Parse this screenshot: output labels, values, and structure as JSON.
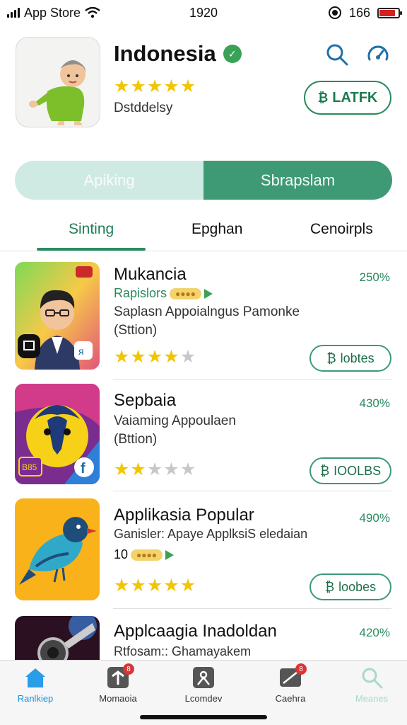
{
  "status_bar": {
    "carrier": "App Store",
    "time": "1920",
    "battery": "166",
    "battery_level": 0.85
  },
  "app": {
    "title": "Indonesia",
    "subtitle": "Dstddelsy",
    "rating": 4.5,
    "get_label": "LATFK",
    "icons": [
      "search-icon",
      "gauge-icon",
      "verified-icon"
    ]
  },
  "segmented": [
    "Apiking",
    "Sbrapslam"
  ],
  "tabs": [
    "Sinting",
    "Epghan",
    "Cenoirpls"
  ],
  "items": [
    {
      "title": "Mukancia",
      "percent": "250%",
      "tagline": "Rapislors",
      "line1": "Saplasn Appoialngus Pamonke",
      "line2": "(Sttion)",
      "rating": 4,
      "button": "lobtes"
    },
    {
      "title": "Sepbaia",
      "percent": "430%",
      "line1": "Vaiaming Appoulaen",
      "line2": "(Bttion)",
      "rating": 1.5,
      "button": "IOOLBS"
    },
    {
      "title": "Applikasia Popular",
      "percent": "490%",
      "line1": "Ganisler: Apaye ApplksiS eledaian",
      "tagline": "10",
      "rating": 5,
      "button": "loobes"
    },
    {
      "title": "Applcaagia Inadoldan",
      "percent": "420%",
      "line1": "Rtfosam:: Ghamayakem"
    }
  ],
  "tabbar": [
    {
      "label": "Ranlkiep",
      "icon": "home-icon",
      "active": true
    },
    {
      "label": "Momaoia",
      "icon": "apps-icon",
      "badge": "8"
    },
    {
      "label": "Lcomdev",
      "icon": "games-icon"
    },
    {
      "label": "Caehra",
      "icon": "updates-icon",
      "badge": "8"
    },
    {
      "label": "Meanes",
      "icon": "search-icon"
    }
  ],
  "colors": {
    "accent": "#2b8a5f",
    "star": "#f2c500",
    "badge": "#d93535"
  }
}
